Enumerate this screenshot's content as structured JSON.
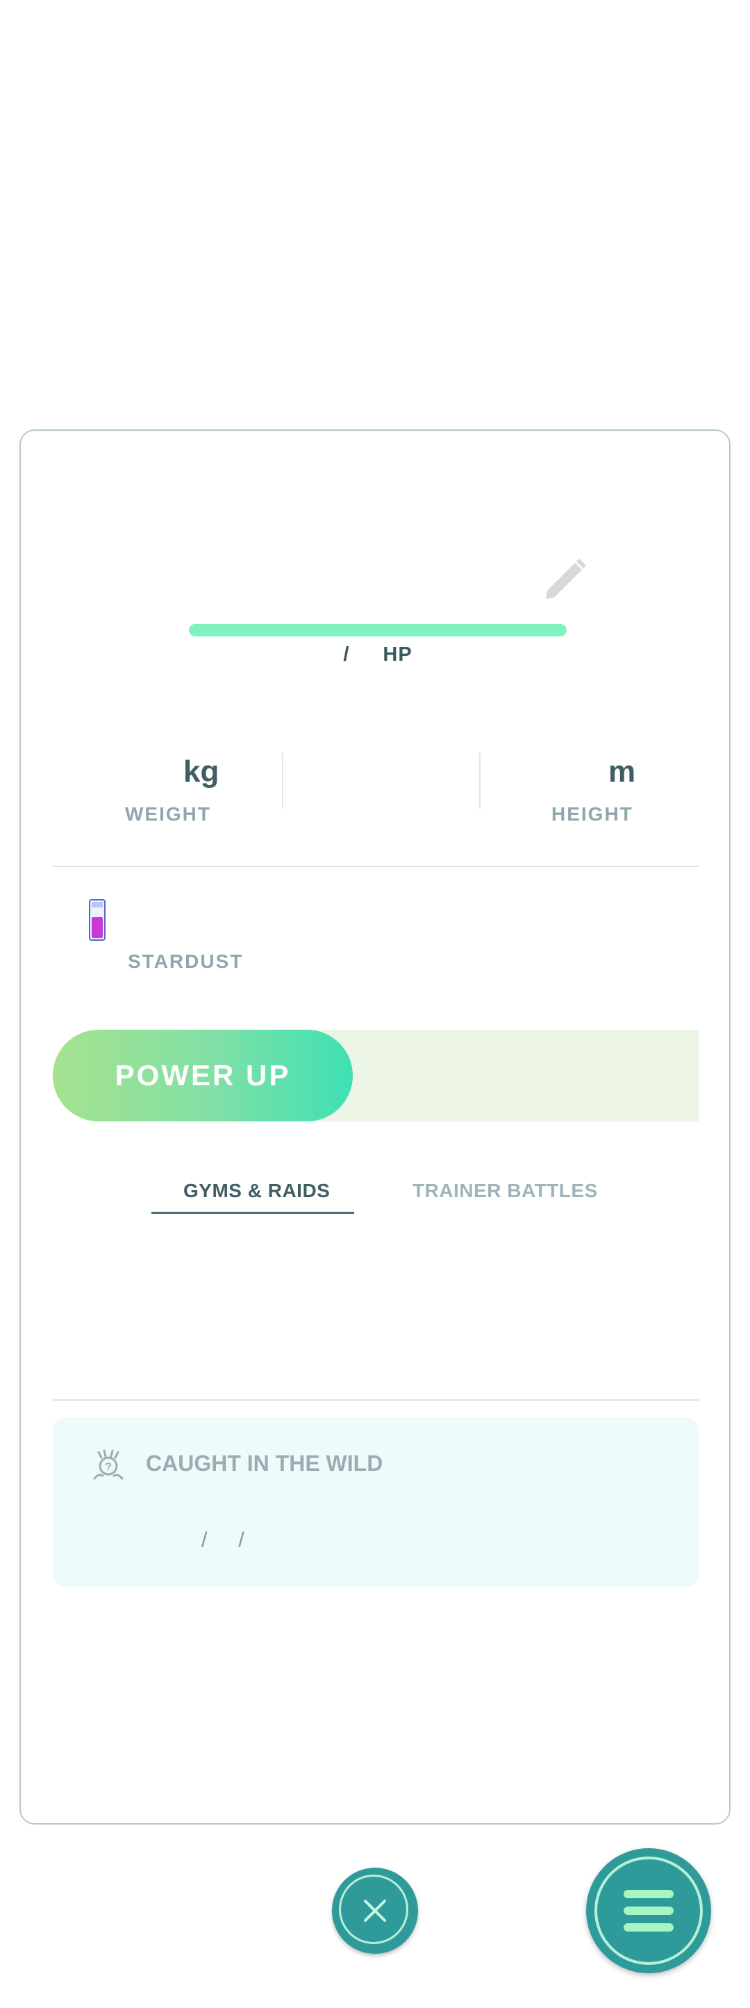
{
  "hp": {
    "separator": "/",
    "unit": "HP",
    "fill_fraction": 1.0
  },
  "stats": {
    "weight_unit": "kg",
    "weight_label": "WEIGHT",
    "height_unit": "m",
    "height_label": "HEIGHT"
  },
  "power_up": {
    "stardust_label": "STARDUST",
    "button_label": "POWER UP"
  },
  "tabs": [
    {
      "label": "GYMS & RAIDS",
      "active": true
    },
    {
      "label": "TRAINER BATTLES",
      "active": false
    }
  ],
  "origin": {
    "title": "CAUGHT IN THE WILD",
    "date_sep1": "/",
    "date_sep2": "/"
  },
  "icons": {
    "edit": "pencil-icon",
    "stardust": "potion-icon",
    "origin": "wild-catch-icon",
    "close": "close-icon",
    "menu": "hamburger-menu-icon"
  },
  "colors": {
    "accent": "#2f9a9a",
    "hp_fill": "#7ff2c0",
    "text_dark": "#3f5e63",
    "text_muted": "#8fa7ad"
  }
}
